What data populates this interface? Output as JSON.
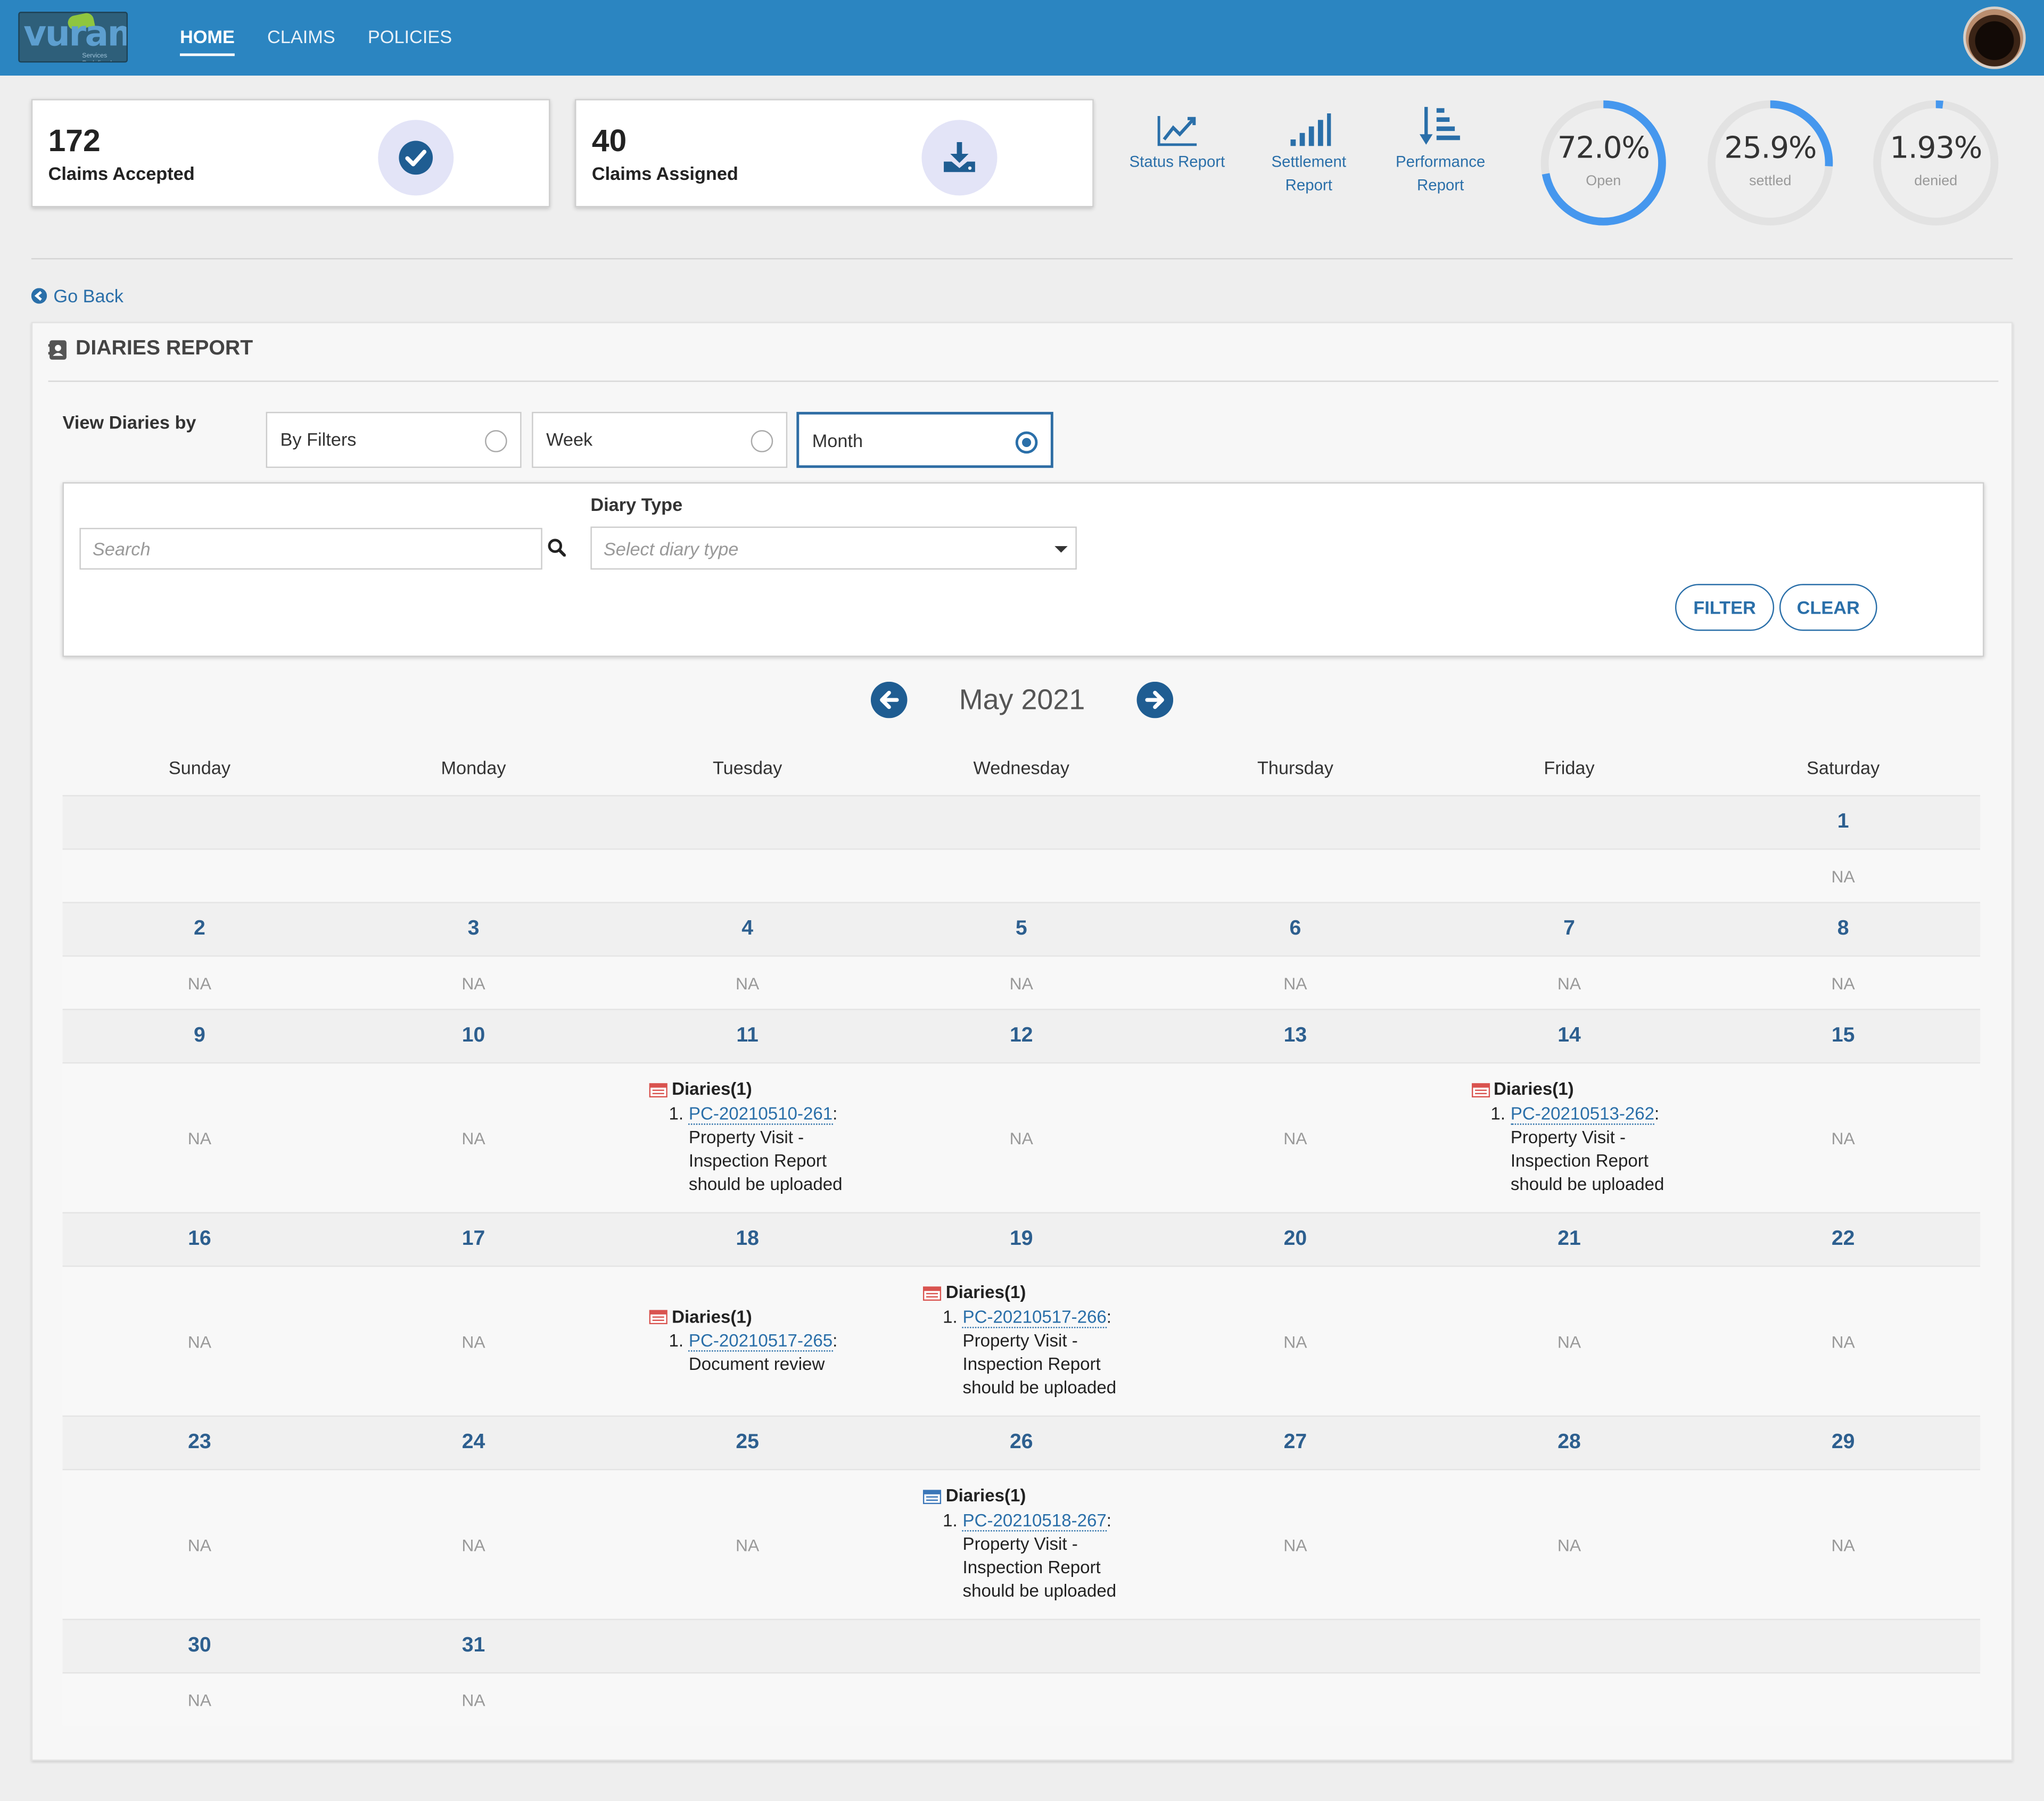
{
  "nav": {
    "logo_text": "vuram",
    "logo_tagline": "Services Redefined",
    "items": [
      "HOME",
      "CLAIMS",
      "POLICIES"
    ]
  },
  "stats": {
    "accepted": {
      "value": "172",
      "label": "Claims Accepted"
    },
    "assigned": {
      "value": "40",
      "label": "Claims Assigned"
    }
  },
  "reports": {
    "status": "Status Report",
    "settlement": "Settlement Report",
    "performance": "Performance Report"
  },
  "rings": [
    {
      "pct": "72.0%",
      "label": "Open",
      "fraction": 0.72
    },
    {
      "pct": "25.9%",
      "label": "settled",
      "fraction": 0.259
    },
    {
      "pct": "1.93%",
      "label": "denied",
      "fraction": 0.0193
    }
  ],
  "colors": {
    "primary": "#2b85c1",
    "accent": "#2a6fa9",
    "ring": "#4597ee",
    "ring_track": "#e2e2e2",
    "diary_red": "#d9534f",
    "diary_blue": "#3a76b8"
  },
  "go_back": "Go Back",
  "report": {
    "title": "DIARIES REPORT",
    "view_by_label": "View Diaries by",
    "options": [
      "By Filters",
      "Week",
      "Month"
    ],
    "selected_option": "Month",
    "search_placeholder": "Search",
    "diary_type_label": "Diary Type",
    "diary_type_placeholder": "Select diary type",
    "filter_label": "FILTER",
    "clear_label": "CLEAR",
    "month_label": "May 2021"
  },
  "calendar": {
    "weekdays": [
      "Sunday",
      "Monday",
      "Tuesday",
      "Wednesday",
      "Thursday",
      "Friday",
      "Saturday"
    ],
    "empty_text": "NA",
    "weeks": [
      {
        "dates": [
          "",
          "",
          "",
          "",
          "",
          "",
          "1"
        ],
        "cells": [
          null,
          null,
          null,
          null,
          null,
          null,
          "NA"
        ]
      },
      {
        "dates": [
          "2",
          "3",
          "4",
          "5",
          "6",
          "7",
          "8"
        ],
        "cells": [
          "NA",
          "NA",
          "NA",
          "NA",
          "NA",
          "NA",
          "NA"
        ]
      },
      {
        "dates": [
          "9",
          "10",
          "11",
          "12",
          "13",
          "14",
          "15"
        ],
        "cells": [
          "NA",
          "NA",
          {
            "header": "Diaries(1)",
            "icon": "red",
            "items": [
              {
                "id": "PC-20210510-261",
                "text": "Property Visit - Inspection Report should be uploaded"
              }
            ]
          },
          "NA",
          "NA",
          {
            "header": "Diaries(1)",
            "icon": "red",
            "items": [
              {
                "id": "PC-20210513-262",
                "text": "Property Visit - Inspection Report should be uploaded"
              }
            ]
          },
          "NA"
        ]
      },
      {
        "dates": [
          "16",
          "17",
          "18",
          "19",
          "20",
          "21",
          "22"
        ],
        "cells": [
          "NA",
          "NA",
          {
            "header": "Diaries(1)",
            "icon": "red",
            "items": [
              {
                "id": "PC-20210517-265",
                "text": "Document review"
              }
            ]
          },
          {
            "header": "Diaries(1)",
            "icon": "red",
            "items": [
              {
                "id": "PC-20210517-266",
                "text": "Property Visit - Inspection Report should be uploaded"
              }
            ]
          },
          "NA",
          "NA",
          "NA"
        ]
      },
      {
        "dates": [
          "23",
          "24",
          "25",
          "26",
          "27",
          "28",
          "29"
        ],
        "cells": [
          "NA",
          "NA",
          "NA",
          {
            "header": "Diaries(1)",
            "icon": "blue",
            "items": [
              {
                "id": "PC-20210518-267",
                "text": "Property Visit - Inspection Report should be uploaded"
              }
            ]
          },
          "NA",
          "NA",
          "NA"
        ]
      },
      {
        "dates": [
          "30",
          "31",
          "",
          "",
          "",
          "",
          ""
        ],
        "cells": [
          "NA",
          "NA",
          null,
          null,
          null,
          null,
          null
        ]
      }
    ]
  }
}
